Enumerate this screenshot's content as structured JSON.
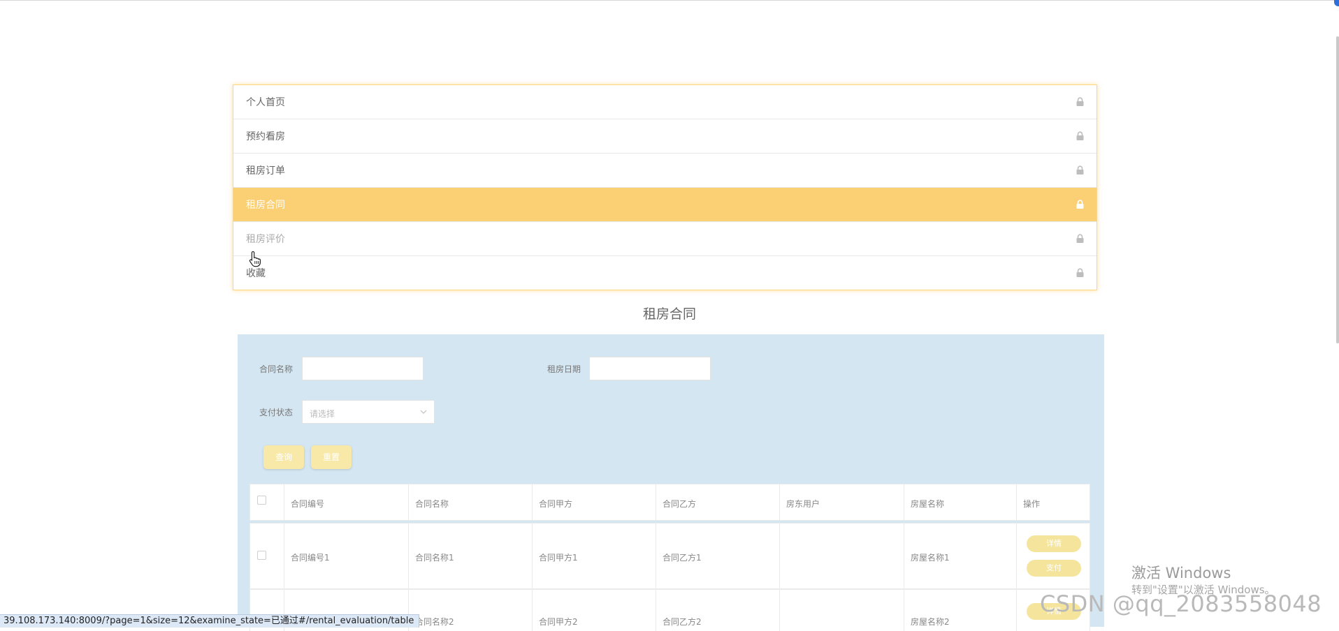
{
  "menu": {
    "items": [
      {
        "label": "个人首页"
      },
      {
        "label": "预约看房"
      },
      {
        "label": "租房订单"
      },
      {
        "label": "租房合同"
      },
      {
        "label": "租房评价"
      },
      {
        "label": "收藏"
      }
    ],
    "active_index": 3,
    "icon": "lock-icon"
  },
  "page": {
    "title": "租房合同"
  },
  "search": {
    "contract_name_label": "合同名称",
    "contract_name_value": "",
    "rent_date_label": "租房日期",
    "rent_date_value": "",
    "pay_status_label": "支付状态",
    "pay_status_placeholder": "请选择",
    "query_button": "查询",
    "reset_button": "重置"
  },
  "table": {
    "headers": [
      "合同编号",
      "合同名称",
      "合同甲方",
      "合同乙方",
      "房东用户",
      "房屋名称",
      "操作"
    ],
    "rows": [
      {
        "no": "合同编号1",
        "name": "合同名称1",
        "party_a": "合同甲方1",
        "party_b": "合同乙方1",
        "landlord": "",
        "house": "房屋名称1"
      },
      {
        "no": "",
        "name": "合同名称2",
        "party_a": "合同甲方2",
        "party_b": "合同乙方2",
        "landlord": "",
        "house": "房屋名称2"
      }
    ],
    "actions": {
      "detail": "详情",
      "pay": "支付"
    }
  },
  "status_bar": {
    "url": "39.108.173.140:8009/?page=1&size=12&examine_state=已通过#/rental_evaluation/table"
  },
  "overlay": {
    "activate_title": "激活 Windows",
    "activate_sub": "转到\"设置\"以激活 Windows。",
    "watermark": "CSDN @qq_2083558048"
  },
  "colors": {
    "accent": "#fbcf74",
    "panel_bg": "#d4e6f2",
    "button": "#f8e9a8"
  }
}
